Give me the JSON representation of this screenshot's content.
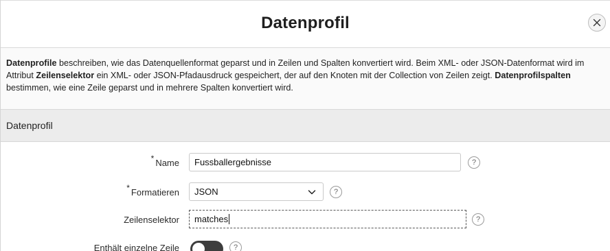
{
  "dialog": {
    "title": "Datenprofil",
    "close_icon": "close-icon"
  },
  "description": {
    "part1_bold": "Datenprofile",
    "part1": " beschreiben, wie das Datenquellenformat geparst und in Zeilen und Spalten konvertiert wird. Beim XML- oder JSON-Datenformat wird im Attribut ",
    "part2_bold": "Zeilenselektor",
    "part2": " ein XML- oder JSON-Pfadausdruck gespeichert, der auf den Knoten mit der Collection von Zeilen zeigt. ",
    "part3_bold": "Datenprofilspalten",
    "part3": " bestimmen, wie eine Zeile geparst und in mehrere Spalten konvertiert wird."
  },
  "region": {
    "title": "Datenprofil"
  },
  "form": {
    "name": {
      "required_marker": "*",
      "label": "Name",
      "value": "Fussballergebnisse",
      "help": "?"
    },
    "format": {
      "required_marker": "*",
      "label": "Formatieren",
      "selected": "JSON",
      "help": "?"
    },
    "row_selector": {
      "label": "Zeilenselektor",
      "value": "matches",
      "help": "?"
    },
    "single_row": {
      "label": "Enthält einzelne Zeile",
      "state": "off",
      "help": "?"
    }
  }
}
